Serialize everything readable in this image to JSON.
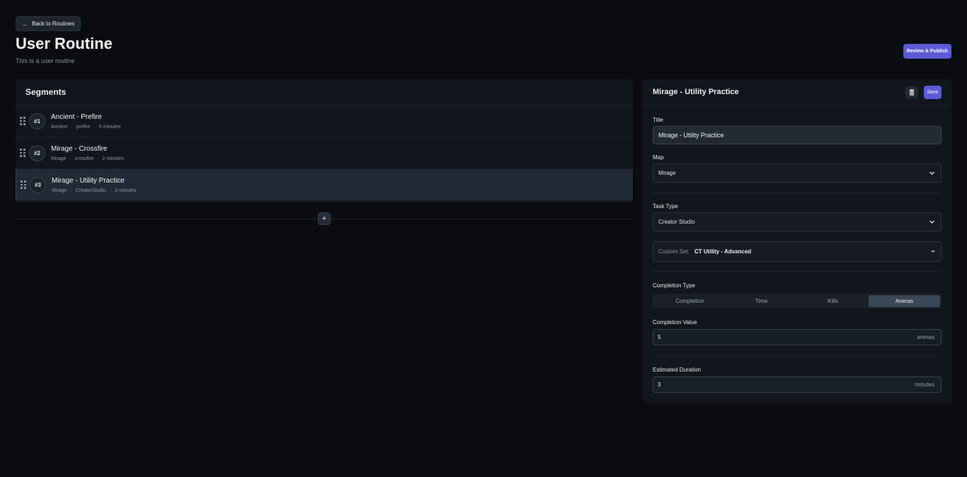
{
  "header": {
    "back_label": "Back to Routines",
    "title": "User Routine",
    "subtitle": "This is a user routine",
    "publish_label": "Review & Publish"
  },
  "segments": {
    "heading": "Segments",
    "items": [
      {
        "number": "#1",
        "title": "Ancient - Prefire",
        "map": "Ancient",
        "type": "prefire",
        "duration": "5 minutes",
        "active": false
      },
      {
        "number": "#2",
        "title": "Mirage - Crossfire",
        "map": "Mirage",
        "type": "crossfire",
        "duration": "2 minutes",
        "active": false
      },
      {
        "number": "#3",
        "title": "Mirage - Utility Practice",
        "map": "Mirage",
        "type": "CreatorStudio",
        "duration": "3 minutes",
        "active": true
      }
    ],
    "add_icon": "plus-icon",
    "meta_separator": "·"
  },
  "editor": {
    "heading": "Mirage - Utility Practice",
    "save_label": "Save",
    "delete_icon": "trash-icon",
    "title_label": "Title",
    "title_value": "Mirage - Utility Practice",
    "map_label": "Map",
    "map_value": "Mirage",
    "task_type_label": "Task Type",
    "task_type_value": "Creator Studio",
    "custom_set_label": "Custom Set:",
    "custom_set_value": "CT Utility - Advanced",
    "completion_type_label": "Completion Type",
    "completion_types": [
      "Completion",
      "Time",
      "Kills",
      "Arenas"
    ],
    "completion_type_selected": "Arenas",
    "completion_value_label": "Completion Value",
    "completion_value": "5",
    "completion_unit": "arenas",
    "duration_label": "Estimated Duration",
    "duration_value": "3",
    "duration_unit": "minutes"
  },
  "colors": {
    "background": "#0a0c10",
    "panel": "#12161c",
    "accent": "#5b5bd6",
    "active_row": "#232a35"
  }
}
